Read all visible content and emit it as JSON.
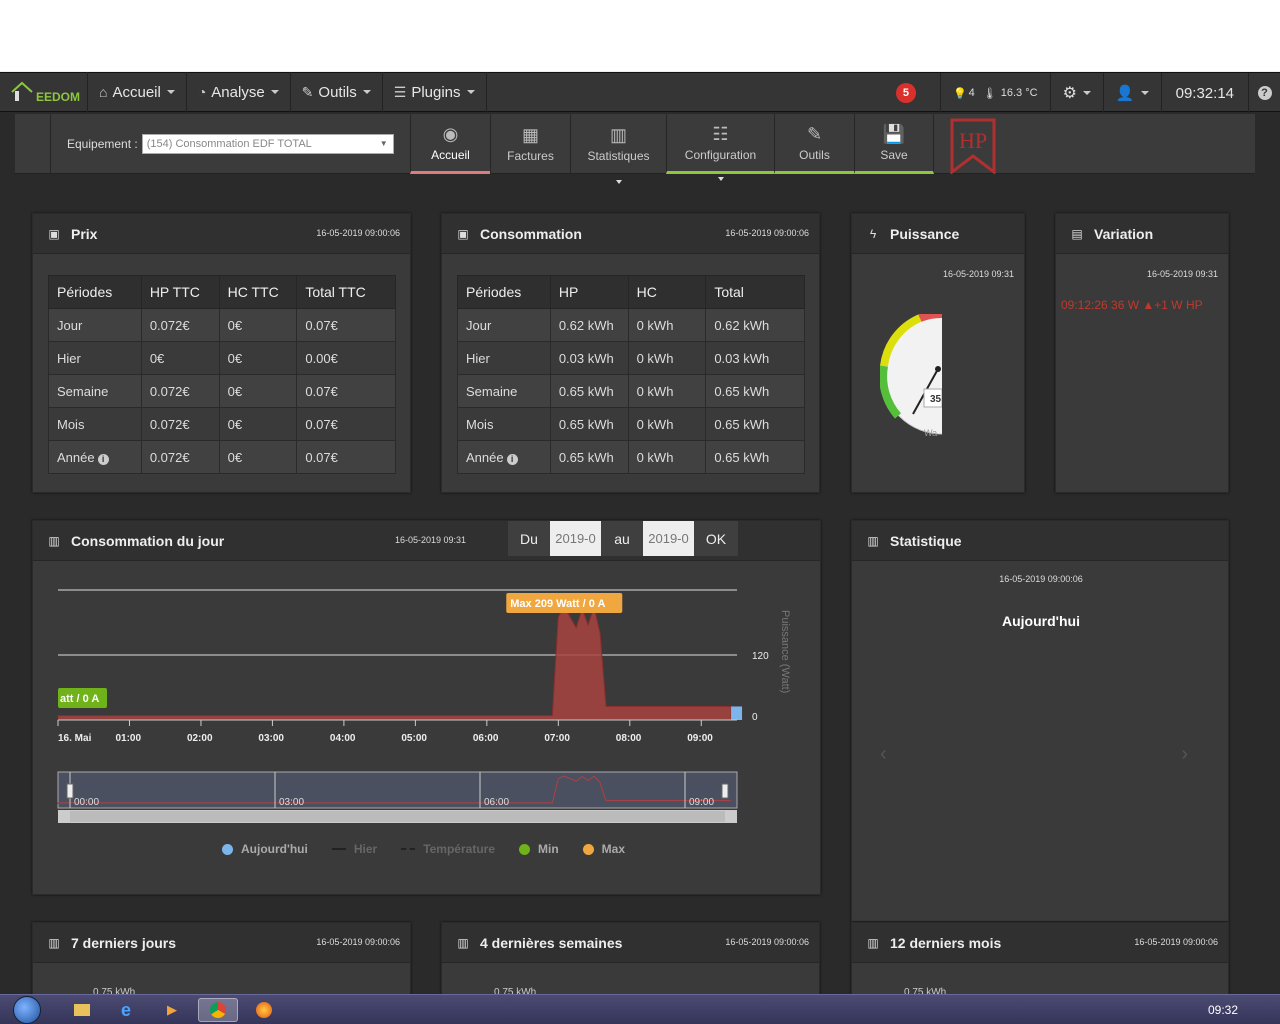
{
  "navbar": {
    "brand": "EEDOM",
    "items": [
      {
        "label": "Accueil",
        "icon": "home-icon"
      },
      {
        "label": "Analyse",
        "icon": "gauge-icon"
      },
      {
        "label": "Outils",
        "icon": "wrench-icon"
      },
      {
        "label": "Plugins",
        "icon": "list-icon"
      }
    ],
    "notifications": "5",
    "sensors": {
      "lights": "4",
      "temperature": "16.3 °C"
    },
    "clock": "09:32:14"
  },
  "toolbar": {
    "equip_label": "Equipement :",
    "equip_value": "(154) Consommation EDF TOTAL",
    "tabs": [
      "Accueil",
      "Factures",
      "Statistiques",
      "Configuration",
      "Outils",
      "Save"
    ],
    "mode_badge": "HP"
  },
  "prix": {
    "title": "Prix",
    "date": "16-05-2019 09:00:06",
    "headers": [
      "Périodes",
      "HP TTC",
      "HC TTC",
      "Total TTC"
    ],
    "rows": [
      [
        "Jour",
        "0.072€",
        "0€",
        "0.07€"
      ],
      [
        "Hier",
        "0€",
        "0€",
        "0.00€"
      ],
      [
        "Semaine",
        "0.072€",
        "0€",
        "0.07€"
      ],
      [
        "Mois",
        "0.072€",
        "0€",
        "0.07€"
      ],
      [
        "Année",
        "0.072€",
        "0€",
        "0.07€"
      ]
    ]
  },
  "conso": {
    "title": "Consommation",
    "date": "16-05-2019 09:00:06",
    "headers": [
      "Périodes",
      "HP",
      "HC",
      "Total"
    ],
    "rows": [
      [
        "Jour",
        "0.62 kWh",
        "0 kWh",
        "0.62 kWh"
      ],
      [
        "Hier",
        "0.03 kWh",
        "0 kWh",
        "0.03 kWh"
      ],
      [
        "Semaine",
        "0.65 kWh",
        "0 kWh",
        "0.65 kWh"
      ],
      [
        "Mois",
        "0.65 kWh",
        "0 kWh",
        "0.65 kWh"
      ],
      [
        "Année",
        "0.65 kWh",
        "0 kWh",
        "0.65 kWh"
      ]
    ]
  },
  "puissance": {
    "title": "Puissance",
    "date": "16-05-2019 09:31",
    "gauge_value": "35",
    "gauge_unit": "Wa"
  },
  "variation": {
    "title": "Variation",
    "date": "16-05-2019 09:31",
    "line": "09:12:26   36 W   ▲+1 W   HP"
  },
  "jour": {
    "title": "Consommation du jour",
    "date": "16-05-2019 09:31",
    "du": "Du",
    "from": "2019-0",
    "au": "au",
    "to": "2019-0",
    "ok": "OK",
    "max_label": "Max 209 Watt / 0 A",
    "min_label": "att / 0 A",
    "ylabel": "Puissance (Watt)",
    "yticks": [
      "120",
      "0"
    ],
    "xticks": [
      "16. Mai",
      "01:00",
      "02:00",
      "03:00",
      "04:00",
      "05:00",
      "06:00",
      "07:00",
      "08:00",
      "09:00"
    ],
    "nav_ticks": [
      "00:00",
      "03:00",
      "06:00",
      "09:00"
    ],
    "legend": [
      "Aujourd'hui",
      "Hier",
      "Température",
      "Min",
      "Max"
    ]
  },
  "statistique": {
    "title": "Statistique",
    "date": "16-05-2019 09:00:06",
    "subtitle": "Aujourd'hui"
  },
  "bottom": [
    {
      "title": "7 derniers jours",
      "date": "16-05-2019 09:00:06",
      "tick": "0.75 kWh"
    },
    {
      "title": "4 dernières semaines",
      "date": "16-05-2019 09:00:06",
      "tick": "0.75 kWh"
    },
    {
      "title": "12 derniers mois",
      "date": "16-05-2019 09:00:06",
      "tick": "0.75 kWh"
    }
  ],
  "taskbar": {
    "time": "09:32"
  },
  "chart_data": {
    "type": "area",
    "title": "Consommation du jour",
    "ylabel": "Puissance (Watt)",
    "ylim": [
      0,
      240
    ],
    "x": [
      "00:00",
      "00:30",
      "01:00",
      "02:00",
      "03:00",
      "04:00",
      "05:00",
      "06:00",
      "06:55",
      "07:00",
      "07:05",
      "07:15",
      "07:20",
      "07:25",
      "07:30",
      "07:35",
      "07:40",
      "08:00",
      "08:30",
      "09:00",
      "09:15",
      "09:25"
    ],
    "series": [
      {
        "name": "Aujourd'hui",
        "values": [
          8,
          8,
          8,
          8,
          8,
          8,
          8,
          8,
          8,
          190,
          209,
          170,
          205,
          175,
          209,
          160,
          25,
          25,
          25,
          25,
          25,
          25
        ]
      }
    ],
    "max": {
      "value": 209,
      "time": "07:05"
    }
  }
}
